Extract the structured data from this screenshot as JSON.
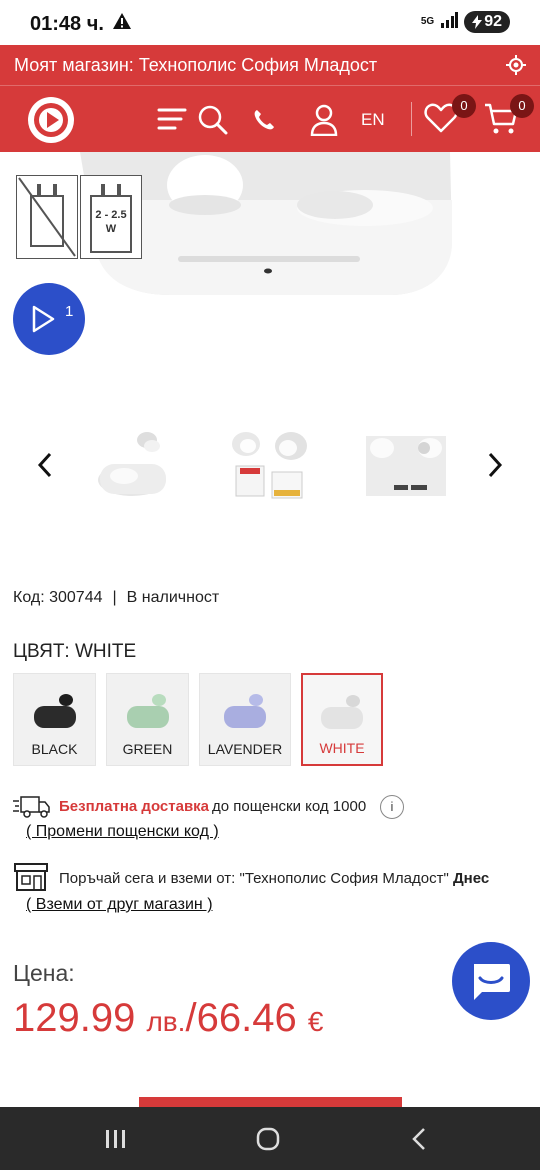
{
  "status_bar": {
    "time": "01:48 ч.",
    "network": "5G",
    "battery": "92"
  },
  "store_bar": {
    "label": "Моят магазин: Технополис София Младост"
  },
  "header": {
    "lang": "EN",
    "wishlist_count": "0",
    "cart_count": "0"
  },
  "gallery": {
    "charger_label": "2 - 2.5\nW",
    "charger_label_line1": "2 - 2.5",
    "charger_label_line2": "W",
    "video_count": "1"
  },
  "product": {
    "code_label": "Код: 300744",
    "availability": "В наличност",
    "color_label": "ЦВЯТ: WHITE",
    "colors": [
      {
        "name": "BLACK",
        "hex": "#2b2b2b",
        "selected": false
      },
      {
        "name": "GREEN",
        "hex": "#a9cfb0",
        "selected": false
      },
      {
        "name": "LAVENDER",
        "hex": "#a9aee0",
        "selected": false
      },
      {
        "name": "WHITE",
        "hex": "#e3e3e3",
        "selected": true
      }
    ]
  },
  "delivery": {
    "free_label": "Безплатна доставка",
    "postcode_text": "до пощенски код 1000",
    "info_icon": "i",
    "change_link": "( Промени пощенски код )"
  },
  "pickup": {
    "text": "Поръчай сега и вземи от:  \"Технополис София Младост\"",
    "today": "Днес",
    "other_store_link": "( Вземи от друг магазин )"
  },
  "price": {
    "label": "Цена:",
    "value_bgn": "129.99",
    "currency_bgn": "лв.",
    "separator": "/",
    "value_eur": "66.46",
    "currency_eur": "€"
  },
  "colors": {
    "brand_red": "#d63a3a",
    "fab_blue": "#2c4fc9"
  }
}
